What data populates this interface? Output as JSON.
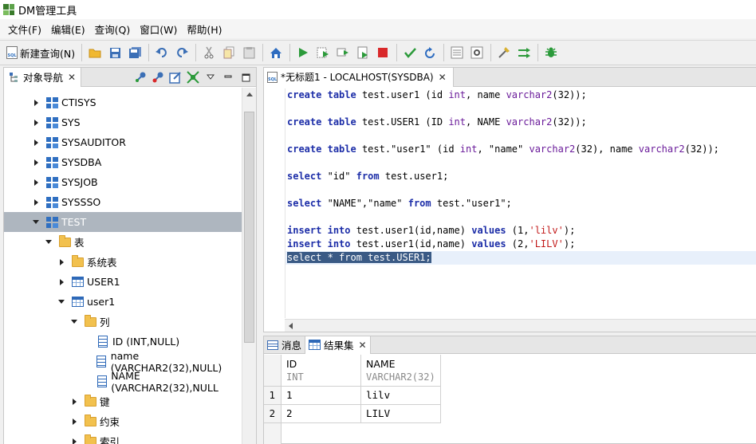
{
  "window": {
    "title": "DM管理工具"
  },
  "menu": [
    "文件(F)",
    "编辑(E)",
    "查询(Q)",
    "窗口(W)",
    "帮助(H)"
  ],
  "toolbar": {
    "new_query_label": "新建查询(N)",
    "icons": [
      "open-folder-icon",
      "save-icon",
      "save-all-icon",
      "undo-icon",
      "redo-icon",
      "cut-icon",
      "copy-icon",
      "paste-icon",
      "home-icon",
      "run-icon",
      "run-selected-icon",
      "step-icon",
      "explain-icon",
      "stop-icon",
      "commit-icon",
      "rollback-icon",
      "plan-icon",
      "settings-icon",
      "format-icon",
      "transfer-icon",
      "debug-icon"
    ]
  },
  "navigator": {
    "tab_label": "对象导航",
    "tree": [
      {
        "label": "CTISYS",
        "level": 0,
        "icon": "schema",
        "state": "collapsed"
      },
      {
        "label": "SYS",
        "level": 0,
        "icon": "schema",
        "state": "collapsed"
      },
      {
        "label": "SYSAUDITOR",
        "level": 0,
        "icon": "schema",
        "state": "collapsed"
      },
      {
        "label": "SYSDBA",
        "level": 0,
        "icon": "schema",
        "state": "collapsed"
      },
      {
        "label": "SYSJOB",
        "level": 0,
        "icon": "schema",
        "state": "collapsed"
      },
      {
        "label": "SYSSSO",
        "level": 0,
        "icon": "schema",
        "state": "collapsed"
      },
      {
        "label": "TEST",
        "level": 0,
        "icon": "schema",
        "state": "expanded",
        "selected": true
      },
      {
        "label": "表",
        "level": 1,
        "icon": "folder",
        "state": "expanded"
      },
      {
        "label": "系统表",
        "level": 2,
        "icon": "folder",
        "state": "collapsed"
      },
      {
        "label": "USER1",
        "level": 2,
        "icon": "table",
        "state": "collapsed"
      },
      {
        "label": "user1",
        "level": 2,
        "icon": "table",
        "state": "expanded"
      },
      {
        "label": "列",
        "level": 3,
        "icon": "folder",
        "state": "expanded"
      },
      {
        "label": "ID (INT,NULL)",
        "level": 4,
        "icon": "column",
        "state": "leaf"
      },
      {
        "label": "name (VARCHAR2(32),NULL)",
        "level": 4,
        "icon": "column",
        "state": "leaf"
      },
      {
        "label": "NAME (VARCHAR2(32),NULL",
        "level": 4,
        "icon": "column",
        "state": "leaf"
      },
      {
        "label": "键",
        "level": 3,
        "icon": "folder",
        "state": "collapsed"
      },
      {
        "label": "约束",
        "level": 3,
        "icon": "folder",
        "state": "collapsed"
      },
      {
        "label": "索引",
        "level": 3,
        "icon": "folder",
        "state": "collapsed"
      }
    ]
  },
  "editor": {
    "tab_label": "*无标题1 - LOCALHOST(SYSDBA)",
    "lines": [
      {
        "line": 1,
        "tokens": [
          [
            "kw",
            "create"
          ],
          [
            "p",
            " "
          ],
          [
            "kw",
            "table"
          ],
          [
            "p",
            " test.user1 (id "
          ],
          [
            "ty",
            "int"
          ],
          [
            "p",
            ", name "
          ],
          [
            "ty",
            "varchar2"
          ],
          [
            "p",
            "(32));"
          ]
        ]
      },
      {
        "line": 3,
        "tokens": [
          [
            "kw",
            "create"
          ],
          [
            "p",
            " "
          ],
          [
            "kw",
            "table"
          ],
          [
            "p",
            " test.USER1 (ID "
          ],
          [
            "ty",
            "int"
          ],
          [
            "p",
            ", NAME "
          ],
          [
            "ty",
            "varchar2"
          ],
          [
            "p",
            "(32));"
          ]
        ]
      },
      {
        "line": 5,
        "tokens": [
          [
            "kw",
            "create"
          ],
          [
            "p",
            " "
          ],
          [
            "kw",
            "table"
          ],
          [
            "p",
            " test.\"user1\" (id "
          ],
          [
            "ty",
            "int"
          ],
          [
            "p",
            ", \"name\" "
          ],
          [
            "ty",
            "varchar2"
          ],
          [
            "p",
            "(32), name "
          ],
          [
            "ty",
            "varchar2"
          ],
          [
            "p",
            "(32));"
          ]
        ]
      },
      {
        "line": 7,
        "tokens": [
          [
            "kw",
            "select"
          ],
          [
            "p",
            " \"id\" "
          ],
          [
            "kw",
            "from"
          ],
          [
            "p",
            " test.user1;"
          ]
        ]
      },
      {
        "line": 9,
        "tokens": [
          [
            "kw",
            "select"
          ],
          [
            "p",
            " \"NAME\",\"name\" "
          ],
          [
            "kw",
            "from"
          ],
          [
            "p",
            " test.\"user1\";"
          ]
        ]
      },
      {
        "line": 11,
        "tokens": [
          [
            "kw",
            "insert"
          ],
          [
            "p",
            " "
          ],
          [
            "kw",
            "into"
          ],
          [
            "p",
            " test.user1(id,name) "
          ],
          [
            "kw",
            "values"
          ],
          [
            "p",
            " (1,"
          ],
          [
            "sq",
            "'lilv'"
          ],
          [
            "p",
            ");"
          ]
        ]
      },
      {
        "line": 12,
        "tokens": [
          [
            "kw",
            "insert"
          ],
          [
            "p",
            " "
          ],
          [
            "kw",
            "into"
          ],
          [
            "p",
            " test.user1(id,name) "
          ],
          [
            "kw",
            "values"
          ],
          [
            "p",
            " (2,"
          ],
          [
            "sq",
            "'LILV'"
          ],
          [
            "p",
            ");"
          ]
        ]
      },
      {
        "line": 13,
        "selected": true,
        "tokens": [
          [
            "p",
            "select * from test.USER1;"
          ]
        ]
      }
    ]
  },
  "results": {
    "tabs": [
      {
        "label": "消息",
        "active": false
      },
      {
        "label": "结果集",
        "active": true
      }
    ],
    "columns": [
      {
        "name": "ID",
        "type": "INT"
      },
      {
        "name": "NAME",
        "type": "VARCHAR2(32)"
      }
    ],
    "rows": [
      {
        "num": "1",
        "cells": [
          "1",
          "lilv"
        ]
      },
      {
        "num": "2",
        "cells": [
          "2",
          "LILV"
        ]
      }
    ]
  }
}
